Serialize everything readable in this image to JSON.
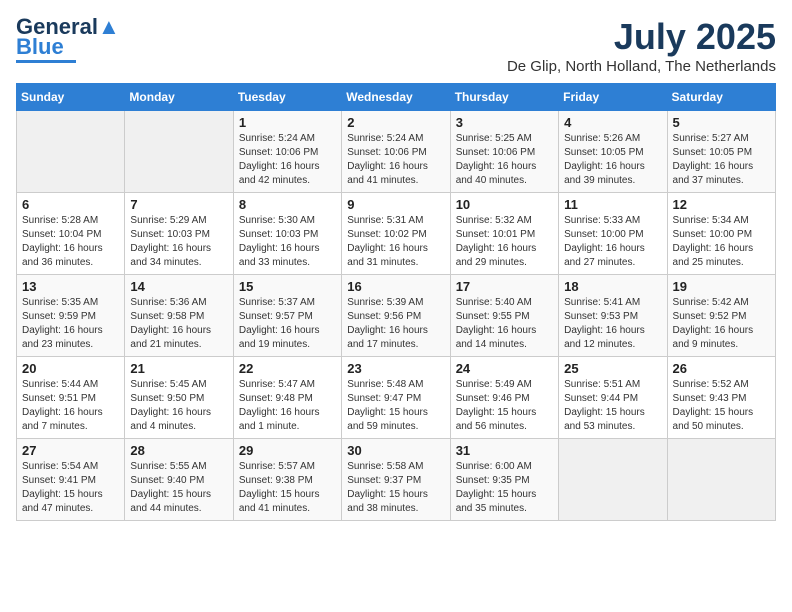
{
  "logo": {
    "line1": "General",
    "line2": "Blue"
  },
  "header": {
    "month": "July 2025",
    "location": "De Glip, North Holland, The Netherlands"
  },
  "days_of_week": [
    "Sunday",
    "Monday",
    "Tuesday",
    "Wednesday",
    "Thursday",
    "Friday",
    "Saturday"
  ],
  "weeks": [
    [
      {
        "num": "",
        "detail": ""
      },
      {
        "num": "",
        "detail": ""
      },
      {
        "num": "1",
        "detail": "Sunrise: 5:24 AM\nSunset: 10:06 PM\nDaylight: 16 hours\nand 42 minutes."
      },
      {
        "num": "2",
        "detail": "Sunrise: 5:24 AM\nSunset: 10:06 PM\nDaylight: 16 hours\nand 41 minutes."
      },
      {
        "num": "3",
        "detail": "Sunrise: 5:25 AM\nSunset: 10:06 PM\nDaylight: 16 hours\nand 40 minutes."
      },
      {
        "num": "4",
        "detail": "Sunrise: 5:26 AM\nSunset: 10:05 PM\nDaylight: 16 hours\nand 39 minutes."
      },
      {
        "num": "5",
        "detail": "Sunrise: 5:27 AM\nSunset: 10:05 PM\nDaylight: 16 hours\nand 37 minutes."
      }
    ],
    [
      {
        "num": "6",
        "detail": "Sunrise: 5:28 AM\nSunset: 10:04 PM\nDaylight: 16 hours\nand 36 minutes."
      },
      {
        "num": "7",
        "detail": "Sunrise: 5:29 AM\nSunset: 10:03 PM\nDaylight: 16 hours\nand 34 minutes."
      },
      {
        "num": "8",
        "detail": "Sunrise: 5:30 AM\nSunset: 10:03 PM\nDaylight: 16 hours\nand 33 minutes."
      },
      {
        "num": "9",
        "detail": "Sunrise: 5:31 AM\nSunset: 10:02 PM\nDaylight: 16 hours\nand 31 minutes."
      },
      {
        "num": "10",
        "detail": "Sunrise: 5:32 AM\nSunset: 10:01 PM\nDaylight: 16 hours\nand 29 minutes."
      },
      {
        "num": "11",
        "detail": "Sunrise: 5:33 AM\nSunset: 10:00 PM\nDaylight: 16 hours\nand 27 minutes."
      },
      {
        "num": "12",
        "detail": "Sunrise: 5:34 AM\nSunset: 10:00 PM\nDaylight: 16 hours\nand 25 minutes."
      }
    ],
    [
      {
        "num": "13",
        "detail": "Sunrise: 5:35 AM\nSunset: 9:59 PM\nDaylight: 16 hours\nand 23 minutes."
      },
      {
        "num": "14",
        "detail": "Sunrise: 5:36 AM\nSunset: 9:58 PM\nDaylight: 16 hours\nand 21 minutes."
      },
      {
        "num": "15",
        "detail": "Sunrise: 5:37 AM\nSunset: 9:57 PM\nDaylight: 16 hours\nand 19 minutes."
      },
      {
        "num": "16",
        "detail": "Sunrise: 5:39 AM\nSunset: 9:56 PM\nDaylight: 16 hours\nand 17 minutes."
      },
      {
        "num": "17",
        "detail": "Sunrise: 5:40 AM\nSunset: 9:55 PM\nDaylight: 16 hours\nand 14 minutes."
      },
      {
        "num": "18",
        "detail": "Sunrise: 5:41 AM\nSunset: 9:53 PM\nDaylight: 16 hours\nand 12 minutes."
      },
      {
        "num": "19",
        "detail": "Sunrise: 5:42 AM\nSunset: 9:52 PM\nDaylight: 16 hours\nand 9 minutes."
      }
    ],
    [
      {
        "num": "20",
        "detail": "Sunrise: 5:44 AM\nSunset: 9:51 PM\nDaylight: 16 hours\nand 7 minutes."
      },
      {
        "num": "21",
        "detail": "Sunrise: 5:45 AM\nSunset: 9:50 PM\nDaylight: 16 hours\nand 4 minutes."
      },
      {
        "num": "22",
        "detail": "Sunrise: 5:47 AM\nSunset: 9:48 PM\nDaylight: 16 hours\nand 1 minute."
      },
      {
        "num": "23",
        "detail": "Sunrise: 5:48 AM\nSunset: 9:47 PM\nDaylight: 15 hours\nand 59 minutes."
      },
      {
        "num": "24",
        "detail": "Sunrise: 5:49 AM\nSunset: 9:46 PM\nDaylight: 15 hours\nand 56 minutes."
      },
      {
        "num": "25",
        "detail": "Sunrise: 5:51 AM\nSunset: 9:44 PM\nDaylight: 15 hours\nand 53 minutes."
      },
      {
        "num": "26",
        "detail": "Sunrise: 5:52 AM\nSunset: 9:43 PM\nDaylight: 15 hours\nand 50 minutes."
      }
    ],
    [
      {
        "num": "27",
        "detail": "Sunrise: 5:54 AM\nSunset: 9:41 PM\nDaylight: 15 hours\nand 47 minutes."
      },
      {
        "num": "28",
        "detail": "Sunrise: 5:55 AM\nSunset: 9:40 PM\nDaylight: 15 hours\nand 44 minutes."
      },
      {
        "num": "29",
        "detail": "Sunrise: 5:57 AM\nSunset: 9:38 PM\nDaylight: 15 hours\nand 41 minutes."
      },
      {
        "num": "30",
        "detail": "Sunrise: 5:58 AM\nSunset: 9:37 PM\nDaylight: 15 hours\nand 38 minutes."
      },
      {
        "num": "31",
        "detail": "Sunrise: 6:00 AM\nSunset: 9:35 PM\nDaylight: 15 hours\nand 35 minutes."
      },
      {
        "num": "",
        "detail": ""
      },
      {
        "num": "",
        "detail": ""
      }
    ]
  ]
}
